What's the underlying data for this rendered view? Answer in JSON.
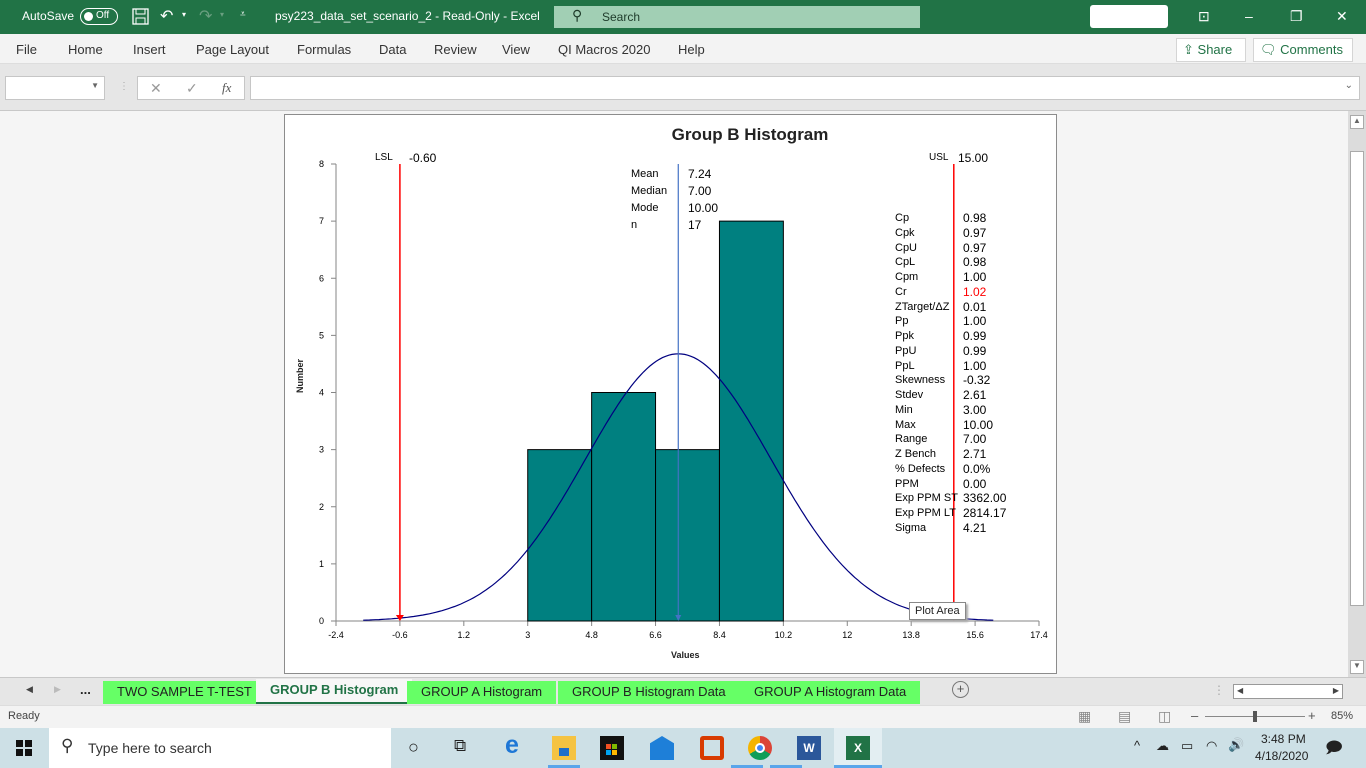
{
  "window": {
    "autosave_label": "AutoSave",
    "autosave_state": "Off",
    "title": "psy223_data_set_scenario_2  -  Read-Only  -  Excel",
    "search_placeholder": "Search"
  },
  "menu": {
    "items": [
      "File",
      "Home",
      "Insert",
      "Page Layout",
      "Formulas",
      "Data",
      "Review",
      "View",
      "QI Macros 2020",
      "Help"
    ],
    "share_label": "Share",
    "comments_label": "Comments"
  },
  "formula_bar": {
    "name_box": "",
    "formula": "",
    "fx_label": "fx"
  },
  "chart_data": {
    "type": "bar",
    "title": "Group B Histogram",
    "xlabel": "Values",
    "ylabel": "Number",
    "xlim": [
      -2.4,
      17.4
    ],
    "ylim": [
      0,
      8
    ],
    "x_ticks": [
      "-2.4",
      "-0.6",
      "1.2",
      "3",
      "4.8",
      "6.6",
      "8.4",
      "10.2",
      "12",
      "13.8",
      "15.6",
      "17.4"
    ],
    "y_ticks": [
      "0",
      "1",
      "2",
      "3",
      "4",
      "5",
      "6",
      "7",
      "8"
    ],
    "bins": [
      {
        "start": 3.0,
        "end": 4.8,
        "count": 3
      },
      {
        "start": 4.8,
        "end": 6.6,
        "count": 4
      },
      {
        "start": 6.6,
        "end": 8.4,
        "count": 3
      },
      {
        "start": 8.4,
        "end": 10.2,
        "count": 7
      }
    ],
    "bar_color": "#008080",
    "normal_curve": {
      "mean": 7.24,
      "stdev": 2.61,
      "n": 17,
      "color": "#000080"
    },
    "lsl": {
      "label": "LSL",
      "value": "-0.60",
      "numeric": -0.6,
      "color": "#ff0000"
    },
    "usl": {
      "label": "USL",
      "value": "15.00",
      "numeric": 15.0,
      "color": "#ff0000"
    },
    "mean_line": {
      "numeric": 7.24,
      "color": "#4472c4"
    },
    "summary": [
      {
        "label": "Mean",
        "value": "7.24"
      },
      {
        "label": "Median",
        "value": "7.00"
      },
      {
        "label": "Mode",
        "value": "10.00"
      },
      {
        "label": "n",
        "value": "17"
      }
    ],
    "capability": [
      {
        "label": "Cp",
        "value": "0.98"
      },
      {
        "label": "Cpk",
        "value": "0.97"
      },
      {
        "label": "CpU",
        "value": "0.97"
      },
      {
        "label": "CpL",
        "value": "0.98"
      },
      {
        "label": "Cpm",
        "value": "1.00"
      },
      {
        "label": "Cr",
        "value": "1.02",
        "highlight": "#ff0000"
      },
      {
        "label": "ZTarget/ΔZ",
        "value": "0.01"
      },
      {
        "label": "Pp",
        "value": "1.00"
      },
      {
        "label": "Ppk",
        "value": "0.99"
      },
      {
        "label": "PpU",
        "value": "0.99"
      },
      {
        "label": "PpL",
        "value": "1.00"
      },
      {
        "label": "Skewness",
        "value": "-0.32"
      },
      {
        "label": "Stdev",
        "value": "2.61"
      },
      {
        "label": "Min",
        "value": "3.00"
      },
      {
        "label": "Max",
        "value": "10.00"
      },
      {
        "label": "Range",
        "value": "7.00"
      },
      {
        "label": "Z Bench",
        "value": "2.71"
      },
      {
        "label": "% Defects",
        "value": "0.0%"
      },
      {
        "label": "PPM",
        "value": "0.00"
      },
      {
        "label": "Exp PPM ST",
        "value": "3362.00"
      },
      {
        "label": "Exp PPM LT",
        "value": "2814.17"
      },
      {
        "label": "Sigma",
        "value": "4.21"
      }
    ],
    "tooltip": "Plot Area"
  },
  "sheet_tabs": {
    "more": "...",
    "tabs": [
      {
        "label": "TWO SAMPLE T-TEST",
        "active": false
      },
      {
        "label": "GROUP B Histogram",
        "active": true
      },
      {
        "label": "GROUP A Histogram",
        "active": false
      },
      {
        "label": "GROUP B Histogram Data",
        "active": false
      },
      {
        "label": "GROUP A Histogram Data",
        "active": false
      }
    ]
  },
  "status": {
    "ready": "Ready",
    "zoom": "85%",
    "zoom_fraction": 0.5
  },
  "taskbar": {
    "search_placeholder": "Type here to search",
    "time": "3:48 PM",
    "date": "4/18/2020"
  }
}
